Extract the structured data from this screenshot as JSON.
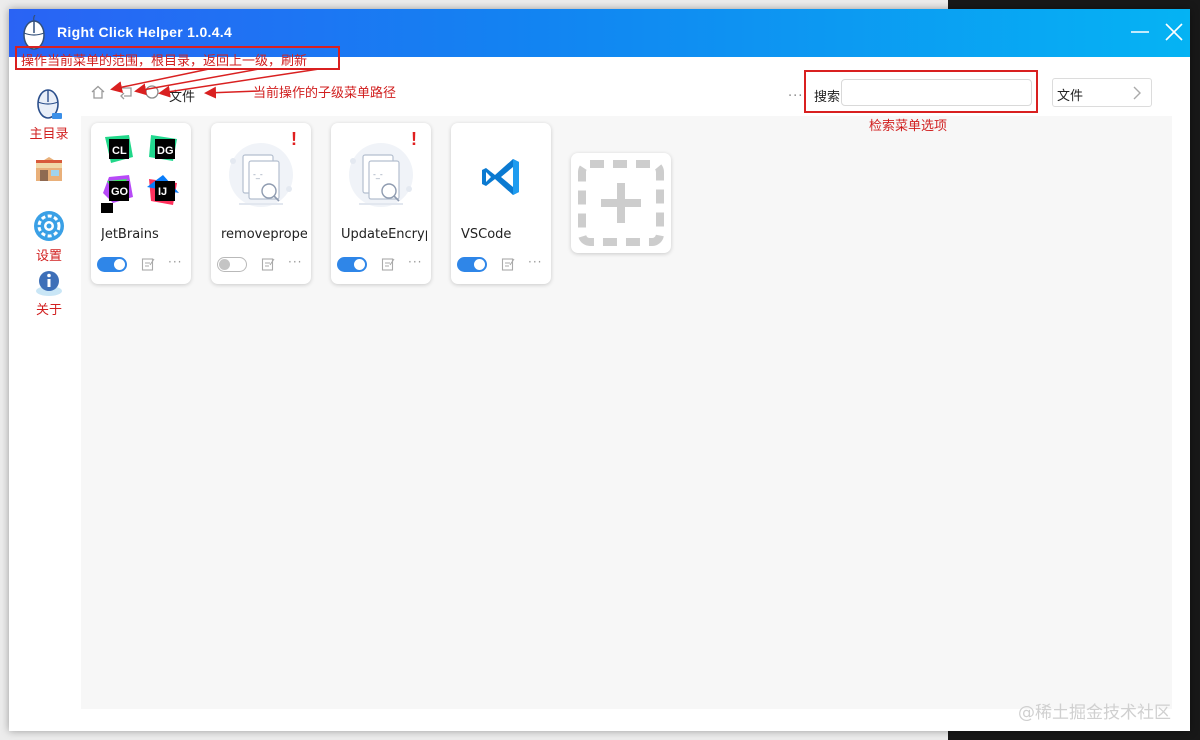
{
  "window": {
    "title": "Right Click Helper 1.0.4.4"
  },
  "sidebar": {
    "items": [
      {
        "icon": "mouse-icon",
        "label": "主目录"
      },
      {
        "icon": "store-icon",
        "label": ""
      },
      {
        "icon": "gear-icon",
        "label": "设置"
      },
      {
        "icon": "info-icon",
        "label": "关于"
      }
    ]
  },
  "annotations": {
    "scope_note": "操作当前菜单的范围，根目录，返回上一级，刷新",
    "path_note": "当前操作的子级菜单路径",
    "search_note": "检索菜单选项"
  },
  "toolbar": {
    "path": "文件",
    "more": "···",
    "search_label": "搜索",
    "search_value": "",
    "file_button": "文件"
  },
  "cards": [
    {
      "name": "JetBrains",
      "enabled": true,
      "warning": false,
      "icon": "jetbrains-icon"
    },
    {
      "name": "removeprope",
      "enabled": false,
      "warning": true,
      "warning_mark": "!",
      "icon": "document-search-icon"
    },
    {
      "name": "UpdateEncryp",
      "enabled": true,
      "warning": true,
      "warning_mark": "!",
      "icon": "document-search-icon"
    },
    {
      "name": "VSCode",
      "enabled": true,
      "warning": false,
      "icon": "vscode-icon"
    }
  ],
  "card_more": "···",
  "watermark": "@稀土掘金技术社区",
  "colors": {
    "title_gradient_start": "#2a63f4",
    "title_gradient_end": "#05b3f3",
    "annotation_red": "#d92020",
    "toggle_on": "#2f86e8"
  }
}
